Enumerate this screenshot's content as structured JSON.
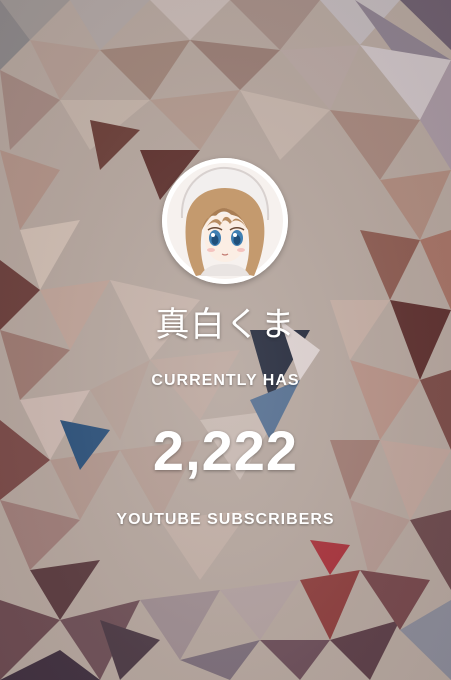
{
  "channel": {
    "name": "真白くま",
    "avatar_icon": "anime-girl-avatar"
  },
  "stats": {
    "prefix_label": "CURRENTLY HAS",
    "subscriber_count": "2,222",
    "suffix_label": "YOUTUBE SUBSCRIBERS"
  },
  "colors": {
    "text": "#ffffff",
    "background_base": "#b9aba3"
  }
}
